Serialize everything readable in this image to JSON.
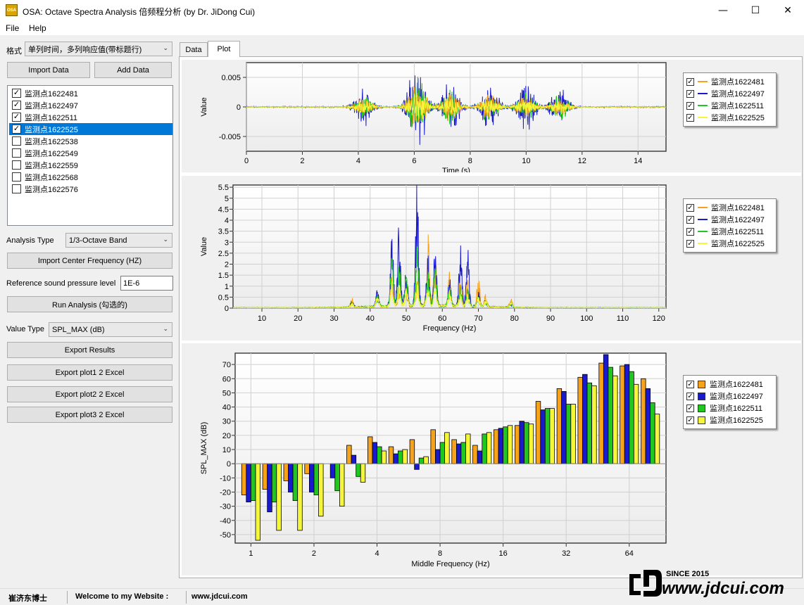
{
  "window": {
    "icon_text": "OSA",
    "title": "OSA: Octave Spectra Analysis 倍频程分析 (by Dr. JiDong Cui)",
    "minimize_glyph": "—",
    "maximize_glyph": "☐",
    "close_glyph": "✕"
  },
  "menu": [
    "File",
    "Help"
  ],
  "left": {
    "format_label": "格式",
    "format_value": "单列时间，多列响应值(带标题行)",
    "import_data": "Import Data",
    "add_data": "Add Data",
    "stations": [
      {
        "name": "监测点1622481",
        "checked": true,
        "selected": false
      },
      {
        "name": "监测点1622497",
        "checked": true,
        "selected": false
      },
      {
        "name": "监测点1622511",
        "checked": true,
        "selected": false
      },
      {
        "name": "监测点1622525",
        "checked": true,
        "selected": true
      },
      {
        "name": "监测点1622538",
        "checked": false,
        "selected": false
      },
      {
        "name": "监测点1622549",
        "checked": false,
        "selected": false
      },
      {
        "name": "监测点1622559",
        "checked": false,
        "selected": false
      },
      {
        "name": "监测点1622568",
        "checked": false,
        "selected": false
      },
      {
        "name": "监测点1622576",
        "checked": false,
        "selected": false
      }
    ],
    "analysis_type_label": "Analysis Type",
    "analysis_type_value": "1/3-Octave Band",
    "import_center_freq": "Import Center Frequency (HZ)",
    "ref_pressure_label": "Reference sound pressure level",
    "ref_pressure_value": "1E-6",
    "run_analysis": "Run Analysis (勾选的)",
    "value_type_label": "Value Type",
    "value_type_value": "SPL_MAX (dB)",
    "export_results": "Export Results",
    "export_plot1": "Export plot1 2 Excel",
    "export_plot2": "Export plot2 2 Excel",
    "export_plot3": "Export plot3 2 Excel"
  },
  "tabs": [
    {
      "label": "Data",
      "active": false
    },
    {
      "label": "Plot",
      "active": true
    }
  ],
  "colors": {
    "s1": "#f7a21b",
    "s2": "#1a1acd",
    "s3": "#1fc71f",
    "s4": "#f5f53a"
  },
  "legend": [
    "监测点1622481",
    "监测点1622497",
    "监测点1622511",
    "监测点1622525"
  ],
  "chart_data": [
    {
      "type": "line",
      "xlabel": "Time (s)",
      "ylabel": "Value",
      "xlim": [
        0,
        15
      ],
      "ylim": [
        -0.0075,
        0.0075
      ],
      "xticks": [
        0,
        2,
        4,
        6,
        8,
        10,
        12,
        14
      ],
      "yticks": [
        -0.005,
        0,
        0.005
      ],
      "ytick_labels": [
        "-0.005",
        "0",
        "0.005"
      ],
      "bursts": [
        {
          "center": 4.2,
          "amp": 0.0035
        },
        {
          "center": 6.1,
          "amp": 0.0085
        },
        {
          "center": 7.3,
          "amp": 0.005
        },
        {
          "center": 8.7,
          "amp": 0.0045
        },
        {
          "center": 10.0,
          "amp": 0.0045
        },
        {
          "center": 11.2,
          "amp": 0.0038
        }
      ]
    },
    {
      "type": "line",
      "xlabel": "Frequency (Hz)",
      "ylabel": "Value",
      "xlim": [
        2,
        122
      ],
      "ylim": [
        0,
        5.6
      ],
      "xticks": [
        10,
        20,
        30,
        40,
        50,
        60,
        70,
        80,
        90,
        100,
        110,
        120
      ],
      "yticks": [
        0,
        0.5,
        1,
        1.5,
        2,
        2.5,
        3,
        3.5,
        4,
        4.5,
        5,
        5.5
      ],
      "peaks": [
        {
          "f": 35,
          "v": [
            0.4,
            0.3,
            0.2,
            0.15
          ]
        },
        {
          "f": 42,
          "v": [
            0.6,
            0.7,
            0.5,
            0.4
          ]
        },
        {
          "f": 46,
          "v": [
            1.2,
            3.6,
            2.5,
            1.0
          ]
        },
        {
          "f": 48,
          "v": [
            0.8,
            3.7,
            1.8,
            0.9
          ]
        },
        {
          "f": 50,
          "v": [
            0.9,
            1.7,
            1.3,
            0.7
          ]
        },
        {
          "f": 53,
          "v": [
            1.6,
            5.6,
            2.6,
            1.0
          ]
        },
        {
          "f": 56,
          "v": [
            3.4,
            2.1,
            1.6,
            0.9
          ]
        },
        {
          "f": 58,
          "v": [
            2.5,
            2.9,
            1.8,
            0.8
          ]
        },
        {
          "f": 62,
          "v": [
            1.4,
            1.2,
            1.0,
            0.6
          ]
        },
        {
          "f": 65,
          "v": [
            1.3,
            2.7,
            0.9,
            0.5
          ]
        },
        {
          "f": 67,
          "v": [
            1.1,
            2.6,
            0.8,
            0.6
          ]
        },
        {
          "f": 70,
          "v": [
            1.4,
            0.6,
            0.5,
            0.4
          ]
        },
        {
          "f": 72,
          "v": [
            0.5,
            0.3,
            0.3,
            0.3
          ]
        },
        {
          "f": 79,
          "v": [
            0.4,
            0.2,
            0.2,
            0.2
          ]
        }
      ]
    },
    {
      "type": "bar",
      "xlabel": "Middle Frequency (Hz)",
      "ylabel": "SPL_MAX (dB)",
      "ylim": [
        -56,
        78
      ],
      "yticks": [
        -50,
        -40,
        -30,
        -20,
        -10,
        0,
        10,
        20,
        30,
        40,
        50,
        60,
        70
      ],
      "xtick_labels": [
        {
          "label": "1",
          "band": 0
        },
        {
          "label": "2",
          "band": 3
        },
        {
          "label": "4",
          "band": 6
        },
        {
          "label": "8",
          "band": 9
        },
        {
          "label": "16",
          "band": 12
        },
        {
          "label": "32",
          "band": 15
        },
        {
          "label": "64",
          "band": 18
        }
      ],
      "series": [
        {
          "name": "监测点1622481",
          "values": [
            -22,
            -18,
            -12,
            -7,
            0,
            13,
            19,
            12,
            17,
            24,
            17,
            13,
            24,
            27,
            44,
            53,
            61,
            71,
            69,
            60
          ]
        },
        {
          "name": "监测点1622497",
          "values": [
            -27,
            -34,
            -20,
            -20,
            -10,
            6,
            15,
            7,
            -4,
            10,
            14,
            9,
            25,
            30,
            38,
            51,
            63,
            77,
            70,
            53
          ]
        },
        {
          "name": "监测点1622511",
          "values": [
            -26,
            -27,
            -26,
            -22,
            -19,
            -9,
            12,
            9,
            4,
            15,
            15,
            21,
            26,
            29,
            39,
            42,
            57,
            68,
            65,
            43
          ]
        },
        {
          "name": "监测点1622525",
          "values": [
            -54,
            -47,
            -47,
            -37,
            -30,
            -13,
            9,
            10,
            5,
            22,
            21,
            22,
            27,
            28,
            39,
            42,
            55,
            62,
            56,
            35
          ]
        }
      ]
    }
  ],
  "status": {
    "author": "崔济东博士",
    "welcome": "Welcome to my Website :",
    "site": "www.jdcui.com"
  },
  "watermark": {
    "since": "SINCE 2015",
    "url": "www.jdcui.com"
  }
}
